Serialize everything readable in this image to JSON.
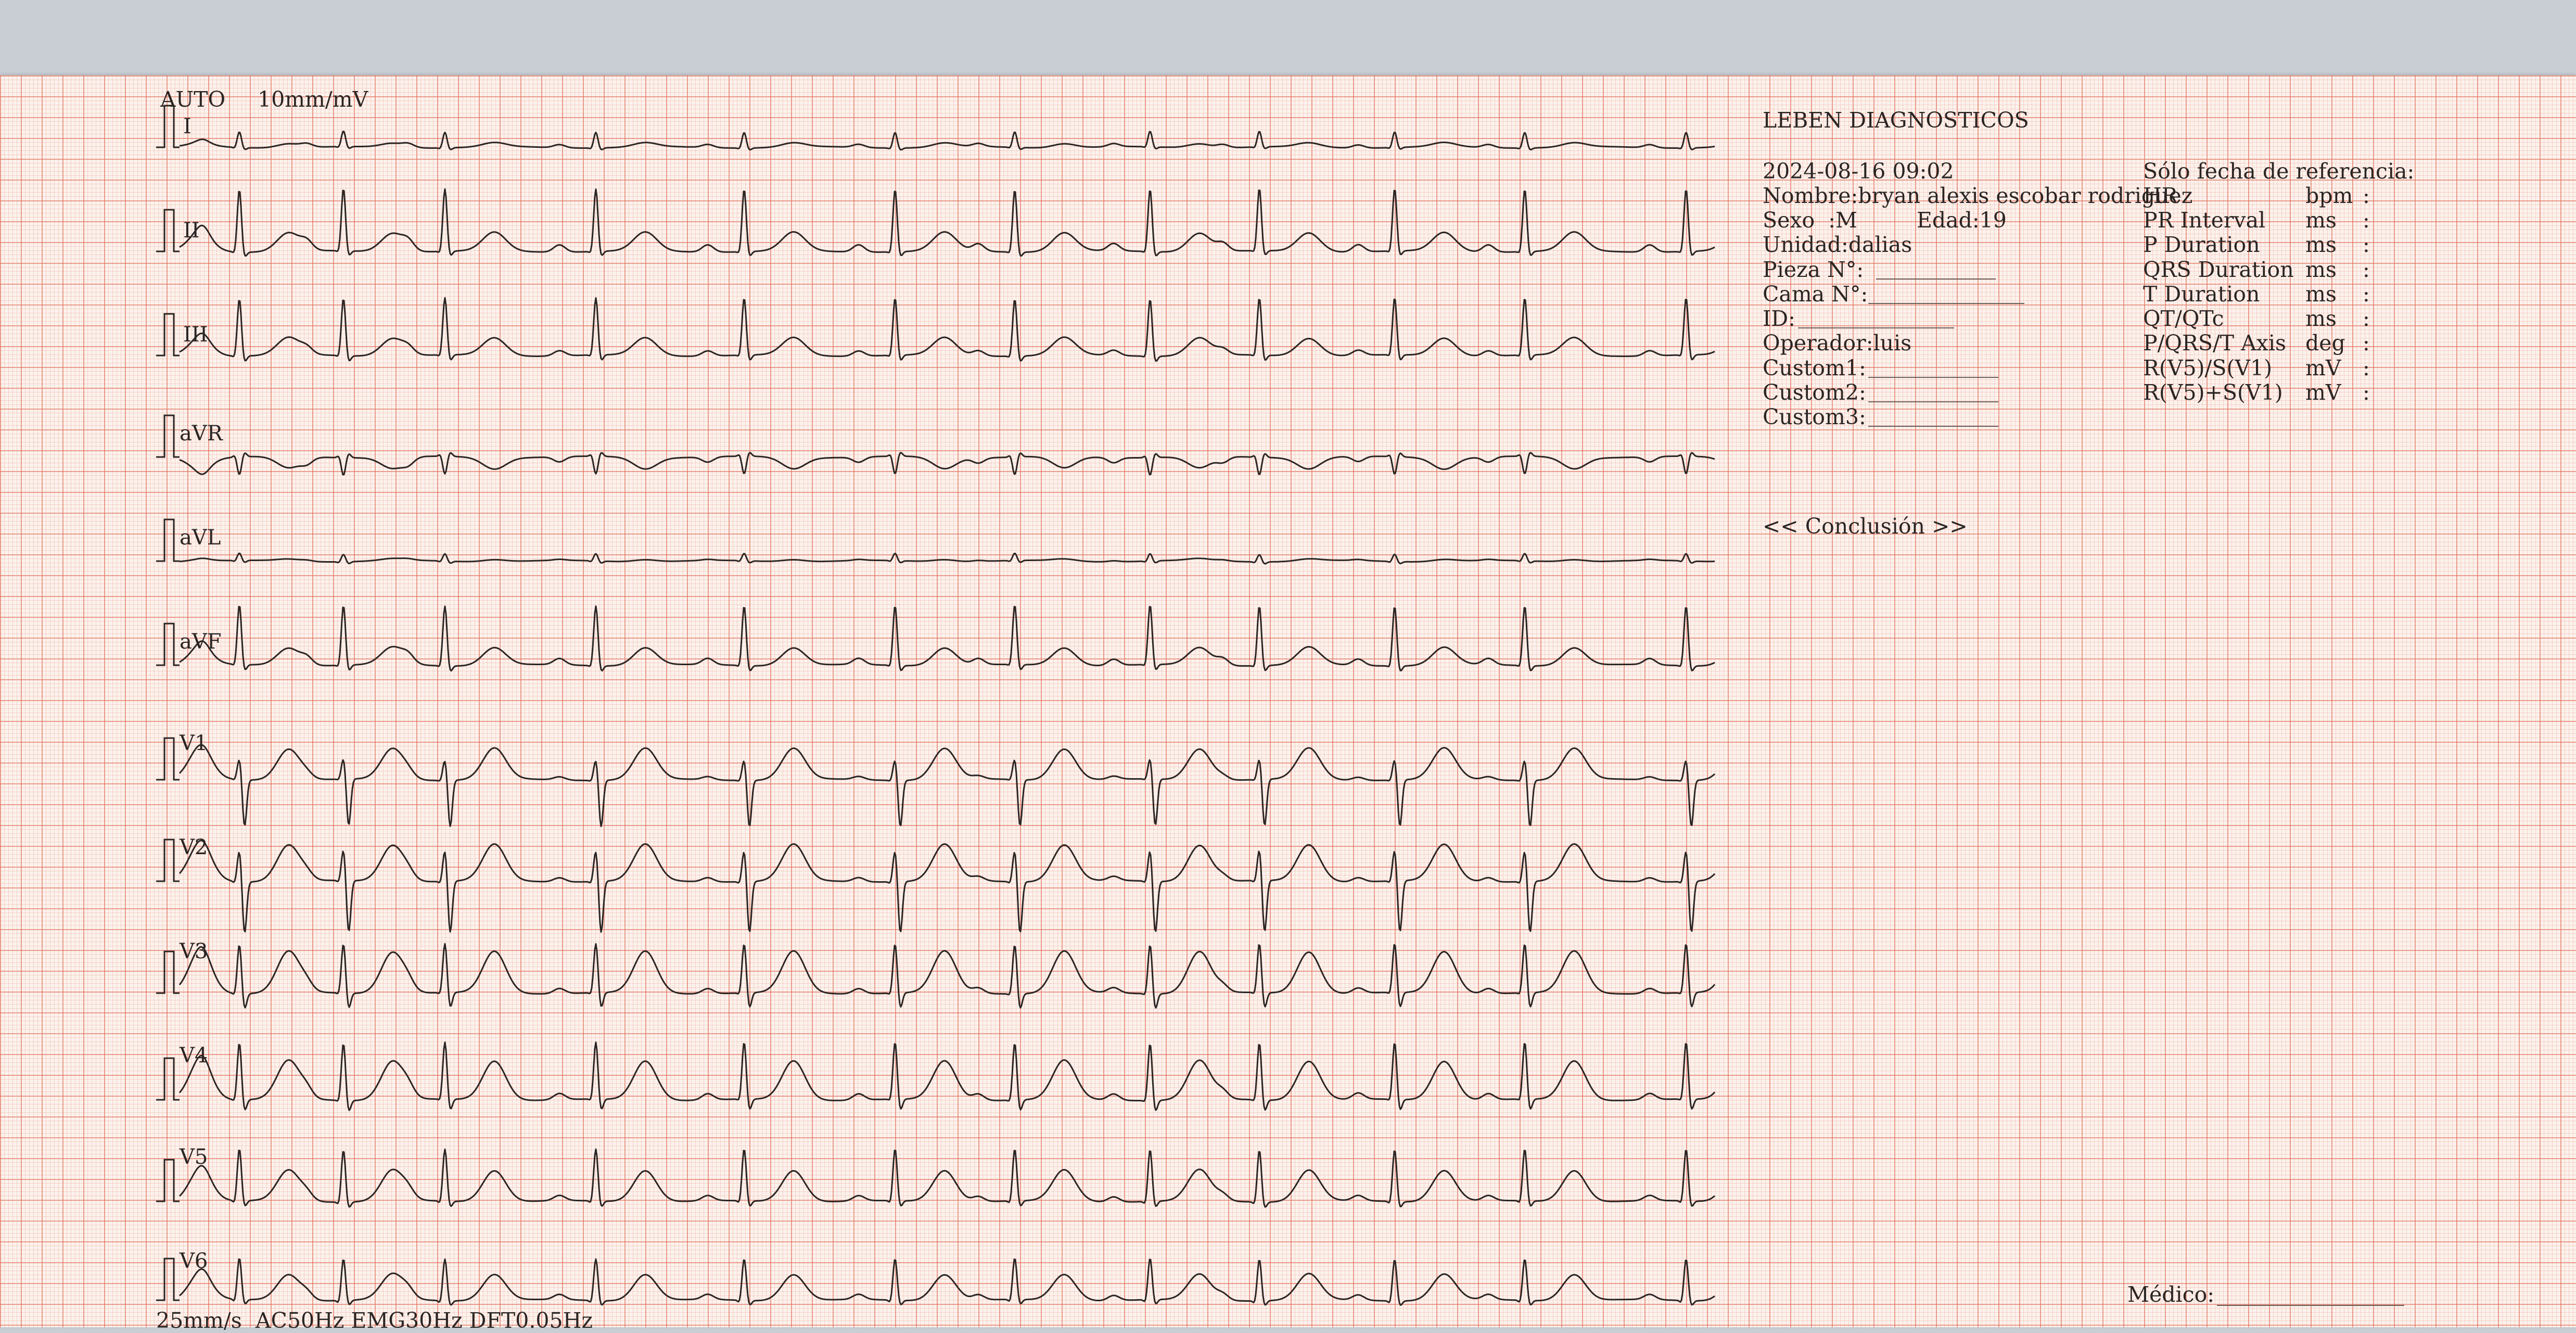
{
  "header": {
    "mode": "AUTO",
    "gain": "10mm/mV"
  },
  "leads": [
    {
      "label": "I"
    },
    {
      "label": "II"
    },
    {
      "label": "III"
    },
    {
      "label": "aVR"
    },
    {
      "label": "aVL"
    },
    {
      "label": "aVF"
    },
    {
      "label": "V1"
    },
    {
      "label": "V2"
    },
    {
      "label": "V3"
    },
    {
      "label": "V4"
    },
    {
      "label": "V5"
    },
    {
      "label": "V6"
    }
  ],
  "footer": {
    "settings": "25mm/s  AC50Hz EMG30Hz DFT0.05Hz"
  },
  "report": {
    "institution": "LEBEN DIAGNOSTICOS",
    "datetime": "2024-08-16 09:02",
    "reference_note": "Sólo fecha de referencia:",
    "nombre": "Nombre:bryan alexis escobar rodriguez",
    "sexo": "Sexo  :M",
    "edad": "Edad:19",
    "unidad": "Unidad:dalias",
    "pieza": "Pieza N°:",
    "cama": "Cama N°:",
    "id": "ID:",
    "operador": "Operador:luis",
    "custom1": "Custom1:",
    "custom2": "Custom2:",
    "custom3": "Custom3:",
    "conclusion": "<< Conclusión >>",
    "medico": "Médico:",
    "measurements": [
      {
        "name": "HR",
        "unit": "bpm",
        "sep": ":"
      },
      {
        "name": "PR Interval",
        "unit": "ms",
        "sep": ":"
      },
      {
        "name": "P Duration",
        "unit": "ms",
        "sep": ":"
      },
      {
        "name": "QRS Duration",
        "unit": "ms",
        "sep": ":"
      },
      {
        "name": "T Duration",
        "unit": "ms",
        "sep": ":"
      },
      {
        "name": "QT/QTc",
        "unit": "ms",
        "sep": ":"
      },
      {
        "name": "P/QRS/T Axis",
        "unit": "deg",
        "sep": ":"
      },
      {
        "name": "R(V5)/S(V1)",
        "unit": "mV",
        "sep": ":"
      },
      {
        "name": "R(V5)+S(V1)",
        "unit": "mV",
        "sep": ":"
      }
    ]
  },
  "colors": {
    "paper": "#fbf2ed",
    "grid_major": "#e2705c",
    "trace": "#2b2523"
  }
}
